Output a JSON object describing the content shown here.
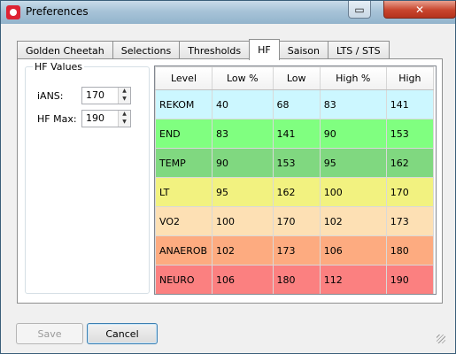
{
  "window": {
    "title": "Preferences"
  },
  "titlebar_buttons": {
    "restore": "▭",
    "close": "✕"
  },
  "tabs": [
    {
      "label": "Golden Cheetah"
    },
    {
      "label": "Selections"
    },
    {
      "label": "Thresholds"
    },
    {
      "label": "HF",
      "active": true
    },
    {
      "label": "Saison"
    },
    {
      "label": "LTS / STS"
    }
  ],
  "hf_values": {
    "title": "HF Values",
    "ians_label": "iANS:",
    "ians_value": "170",
    "hfmax_label": "HF Max:",
    "hfmax_value": "190"
  },
  "table": {
    "headers": [
      "Level",
      "Low %",
      "Low",
      "High %",
      "High"
    ],
    "rows": [
      {
        "cells": [
          "REKOM",
          "40",
          "68",
          "83",
          "141"
        ],
        "color": "#ccf7ff"
      },
      {
        "cells": [
          "END",
          "83",
          "141",
          "90",
          "153"
        ],
        "color": "#80ff80"
      },
      {
        "cells": [
          "TEMP",
          "90",
          "153",
          "95",
          "162"
        ],
        "color": "#80d880"
      },
      {
        "cells": [
          "LT",
          "95",
          "162",
          "100",
          "170"
        ],
        "color": "#f2f280"
      },
      {
        "cells": [
          "VO2",
          "100",
          "170",
          "102",
          "173"
        ],
        "color": "#fde0b4"
      },
      {
        "cells": [
          "ANAEROB",
          "102",
          "173",
          "106",
          "180"
        ],
        "color": "#fdab80"
      },
      {
        "cells": [
          "NEURO",
          "106",
          "180",
          "112",
          "190"
        ],
        "color": "#fb8080"
      }
    ]
  },
  "buttons": {
    "save": "Save",
    "cancel": "Cancel"
  }
}
